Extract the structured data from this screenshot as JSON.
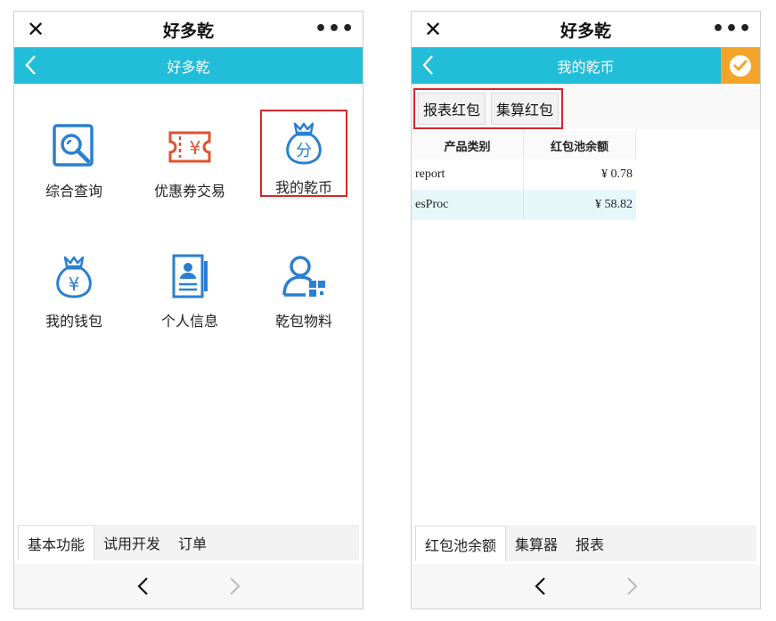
{
  "left": {
    "window_title": "好多乾",
    "close_glyph": "✕",
    "more_glyph": "•••",
    "nav_title": "好多乾",
    "tiles": [
      {
        "label": "综合查询",
        "icon": "search-report-icon"
      },
      {
        "label": "优惠券交易",
        "icon": "coupon-icon"
      },
      {
        "label": "我的乾币",
        "icon": "money-bag-fen-icon"
      },
      {
        "label": "我的钱包",
        "icon": "money-bag-yen-icon"
      },
      {
        "label": "个人信息",
        "icon": "id-card-icon"
      },
      {
        "label": "乾包物料",
        "icon": "user-qr-icon"
      }
    ],
    "tabs": [
      "基本功能",
      "试用开发",
      "订单"
    ]
  },
  "right": {
    "window_title": "好多乾",
    "close_glyph": "✕",
    "more_glyph": "•••",
    "nav_title": "我的乾币",
    "buttons": [
      "报表红包",
      "集算红包"
    ],
    "table": {
      "headers": [
        "产品类别",
        "红包池余额"
      ],
      "rows": [
        {
          "product": "report",
          "balance": "¥ 0.78"
        },
        {
          "product": "esProc",
          "balance": "¥ 58.82"
        }
      ]
    },
    "tabs": [
      "红包池余额",
      "集算器",
      "报表"
    ]
  },
  "colors": {
    "accent": "#22bdd9",
    "icon_blue": "#2a7fd0",
    "coupon_red": "#e0522f",
    "confirm_orange": "#f5a42a",
    "highlight_red": "#d8262b"
  }
}
